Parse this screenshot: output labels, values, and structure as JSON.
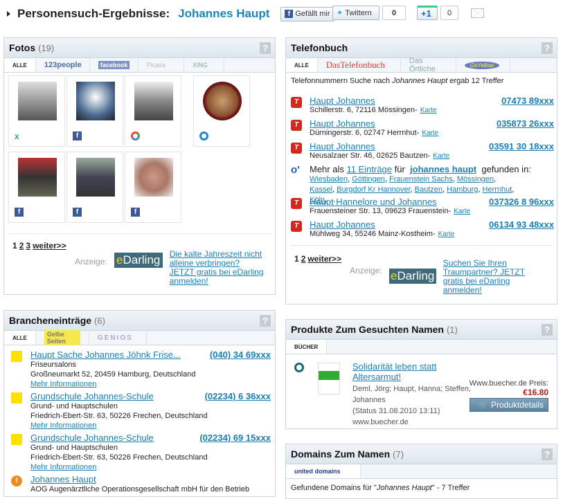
{
  "header": {
    "title": "Personensuch-Ergebnisse:",
    "name": "Johannes Haupt",
    "like": "Gefällt mir",
    "twitter": "Twittern",
    "twitter_count": "0",
    "plusone": "+1",
    "plusone_count": "0"
  },
  "fotos": {
    "title": "Fotos",
    "count": "(19)",
    "tabs": [
      "ALLE",
      "123people",
      "facebook",
      "Picasa",
      "XING"
    ],
    "pages": [
      "1",
      "2",
      "3"
    ],
    "next": "weiter>>",
    "ad_label": "Anzeige:",
    "ad_logo": "eDarling",
    "ad_text": "Die kalte Jahreszeit nicht alleine verbringen? JETZT gratis bei eDarling anmelden!"
  },
  "telefonbuch": {
    "title": "Telefonbuch",
    "tabs": [
      "ALLE",
      "DasTelefonbuch",
      "Das Örtliche",
      "GoYellow"
    ],
    "intro_pre": "Telefonnummern Suche nach ",
    "intro_name": "Johannes Haupt",
    "intro_post": " ergab 12 Treffer",
    "entries": [
      {
        "name": "Haupt Johannes",
        "number": "07473 89xxx",
        "address": "Schillerstr. 6, 72116 Mössingen-",
        "map": "Karte"
      },
      {
        "name": "Haupt Johannes",
        "number": "035873 26xxx",
        "address": "Dürningerstr. 6, 02747 Herrnhut-",
        "map": "Karte"
      },
      {
        "name": "Haupt Johannes",
        "number": "03591 30 18xxx",
        "address": "Neusalzaer Str. 46, 02625 Bautzen-",
        "map": "Karte"
      }
    ],
    "more": {
      "pre": "Mehr als",
      "link": "11 Einträge",
      "mid": "für",
      "query": "johannes haupt",
      "post": "gefunden in:",
      "cities": [
        "Wiesbaden",
        "Göttingen",
        "Frauenstein Sachs",
        "Mössingen",
        "Kassel",
        "Burgdorf Kr Hannover",
        "Bautzen",
        "Hamburg",
        "Herrnhut",
        "Köln"
      ],
      "ellipsis": "..."
    },
    "entries2": [
      {
        "name": "Haupt Hannelore und Johannes",
        "number": "037326 8 96xxx",
        "address": "Frauensteiner Str. 13, 09623 Frauenstein-",
        "map": "Karte"
      },
      {
        "name": "Haupt Johannes",
        "number": "06134 93 48xxx",
        "address": "Mühlweg 34, 55246 Mainz-Kostheim-",
        "map": "Karte"
      }
    ],
    "pages": [
      "1",
      "2"
    ],
    "next": "weiter>>",
    "ad_label": "Anzeige:",
    "ad_logo": "eDarling",
    "ad_text": "Suchen Sie Ihren Traumpartner? JETZT gratis bei eDarling anmelden!"
  },
  "branchen": {
    "title": "Brancheneinträge",
    "count": "(6)",
    "tabs": [
      "ALLE",
      "Gelbe Seiten",
      "GENIOS"
    ],
    "entries": [
      {
        "name": "Haupt Sache Johannes Jöhnk Frise...",
        "number": "(040) 34 69xxx",
        "category": "Friseursalons",
        "address": "Großneumarkt 52, 20459 Hamburg, Deutschland",
        "more": "Mehr Informationen"
      },
      {
        "name": "Grundschule Johannes-Schule",
        "number": "(02234) 6 36xxx",
        "category": "Grund- und Hauptschulen",
        "address": "Friedrich-Ebert-Str. 63, 50226 Frechen, Deutschland",
        "more": "Mehr Informationen"
      },
      {
        "name": "Grundschule Johannes-Schule",
        "number": "(02234) 69 15xxx",
        "category": "Grund- und Hauptschulen",
        "address": "Friedrich-Ebert-Str. 63, 50226 Frechen, Deutschland",
        "more": "Mehr Informationen"
      }
    ],
    "last": {
      "name": "Johannes Haupt",
      "category": "AOG Augenärztliche Operationsgesellschaft mbH für den Betrieb"
    }
  },
  "produkte": {
    "title": "Produkte Zum Gesuchten Namen",
    "count": "(1)",
    "tab": "BÜCHER",
    "book_title": "Solidarität leben statt Altersarmut!",
    "authors": "Deml, Jörg; Haupt, Hanna; Steffen, Johannes",
    "status": "(Status 31.08.2010 13:11)",
    "shop": "www.buecher.de",
    "price_label": "Www.buecher.de Preis:",
    "price": "€16.80",
    "button": "Produktdetails",
    "price_color": "#b01c1c"
  },
  "domains": {
    "title": "Domains Zum Namen",
    "count": "(7)",
    "tab": "united domains",
    "intro_pre": "Gefundene Domains für \"",
    "intro_name": "Johannes Haupt",
    "intro_post": "\" - 7 Treffer"
  }
}
